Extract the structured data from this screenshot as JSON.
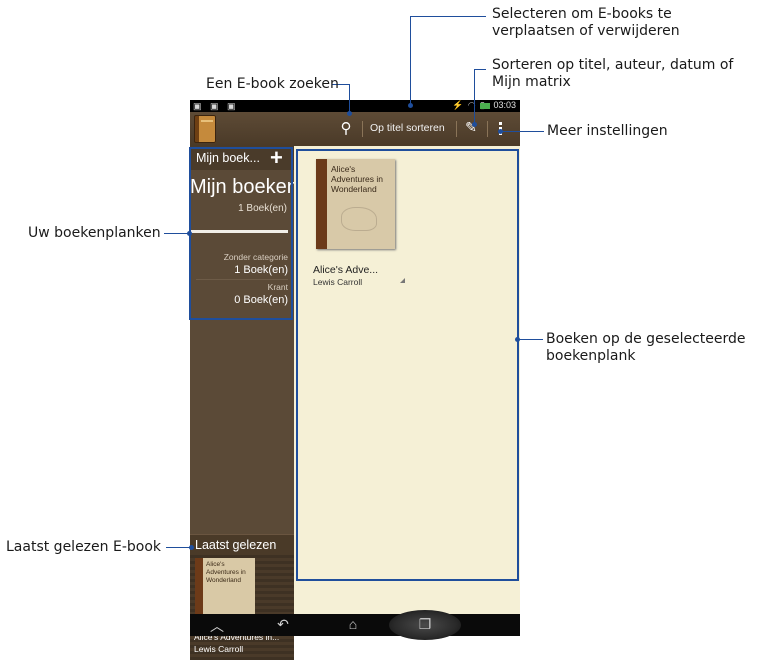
{
  "status_bar": {
    "time": "03:03"
  },
  "action_bar": {
    "search_icon": "search-icon",
    "sort_label": "Op titel sorteren",
    "edit_icon": "pencil-icon",
    "menu_icon": "overflow-menu-icon"
  },
  "sidebar": {
    "header_title": "Mijn boek...",
    "add_label": "+",
    "shelf_title": "Mijn boeken",
    "shelf_count": "1 Boek(en)",
    "categories": [
      {
        "label": "Zonder categorie",
        "count": "1 Boek(en)"
      },
      {
        "label": "Krant",
        "count": "0 Boek(en)"
      }
    ],
    "recent_header": "Laatst gelezen",
    "recent_cover_text": "Alice's Adventures in Wonderland",
    "recent_title": "Alice's Adventures in...",
    "recent_author": "Lewis Carroll"
  },
  "main": {
    "book": {
      "cover_text": "Alice's Adventures in Wonderland",
      "title": "Alice's Adve...",
      "author": "Lewis Carroll"
    }
  },
  "callouts": {
    "select": "Selecteren om E-books te verplaatsen of verwijderen",
    "sort": "Sorteren op titel, auteur, datum of Mijn matrix",
    "search": "Een E-book zoeken",
    "settings": "Meer instellingen",
    "shelves": "Uw boekenplanken",
    "books": "Boeken op de geselecteerde boekenplank",
    "recent": "Laatst gelezen E-book"
  },
  "colors": {
    "callout_line": "#1f4e9c",
    "shelf_bg": "#5b4a37",
    "content_bg": "#f5f0d6"
  }
}
